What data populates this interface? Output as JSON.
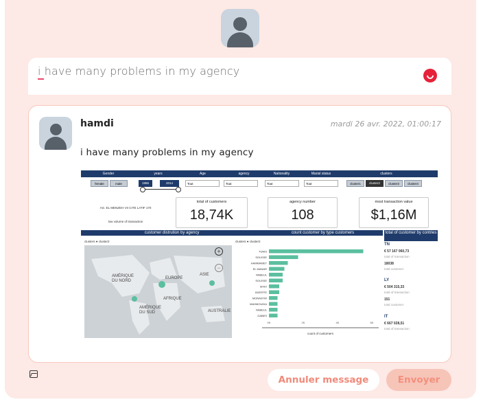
{
  "composer": {
    "text": "i have many problems in my agency"
  },
  "post": {
    "author": "hamdi",
    "date": "mardi 26 avr. 2022, 01:00:17",
    "message": "i have many problems in my agency"
  },
  "dashboard": {
    "filters": [
      "Gender",
      "years",
      "Age",
      "agency",
      "Nationality",
      "Marial status",
      "clusters"
    ],
    "gender_options": [
      "female",
      "male"
    ],
    "years": [
      "1986",
      "2014"
    ],
    "dropdown_values": [
      "Tout",
      "Tout",
      "Tout",
      "Tout"
    ],
    "cluster_options": [
      "cluster1",
      "cluster2",
      "cluster3",
      "cluster4"
    ],
    "agency_card": {
      "name": "AG. EL MENZEH VII CITE LATIF 170",
      "note": "low volume of transaction"
    },
    "kpis": [
      {
        "title": "total of customers",
        "value": "18,74K"
      },
      {
        "title": "agency number",
        "value": "108"
      },
      {
        "title": "most transaction value",
        "value": "$1,16M"
      }
    ],
    "sections": [
      "customer distrution by agency",
      "count customer by type customers",
      "total of customer by contries"
    ],
    "map_legend": "clusters  ● cluster2",
    "bar_legend": "clusters  ● cluster2",
    "bar_xlabel": "count of customers",
    "bar_ticks": [
      "0K",
      "2K",
      "4K",
      "6K"
    ],
    "map_labels": [
      "AMÉRIQUE DU NORD",
      "EUROPE",
      "AFRIQUE",
      "AMÉRIQUE DU SUD",
      "ASIE",
      "AUSTRALIE"
    ],
    "countries": [
      {
        "code": "TN",
        "amount": "€ 57 167 060,73",
        "amount_label": "total of transaction",
        "count": "18038",
        "count_label": "total customer"
      },
      {
        "code": "LY",
        "amount": "€ 504 315,33",
        "amount_label": "total of transaction",
        "count": "151",
        "count_label": "total customer"
      },
      {
        "code": "IT",
        "amount": "€ 667 028,51",
        "amount_label": "total of transaction",
        "count": "",
        "count_label": ""
      }
    ]
  },
  "chart_data": {
    "type": "bar",
    "title": "count customer by type customers",
    "xlabel": "count of customers",
    "orientation": "horizontal",
    "categories": [
      "TUNIS",
      "SOUSSE",
      "HAMMAMET",
      "EL MANAR",
      "NABEUL",
      "SOUSSE",
      "SFAX",
      "BIZERTE",
      "MONASTIR",
      "MAHMOUDIA",
      "NABEUL",
      "GABES"
    ],
    "values": [
      5.5,
      1.7,
      1.1,
      0.9,
      0.8,
      0.8,
      0.6,
      0.6,
      0.5,
      0.5,
      0.5,
      0.5
    ],
    "xlim": [
      0,
      6
    ]
  },
  "footer": {
    "cancel": "Annuler message",
    "send": "Envoyer"
  },
  "colors": {
    "accent": "#f06a6a",
    "panel": "#fde9e5",
    "dashboard_blue": "#1f3b6b",
    "bar": "#5bbf9f"
  }
}
